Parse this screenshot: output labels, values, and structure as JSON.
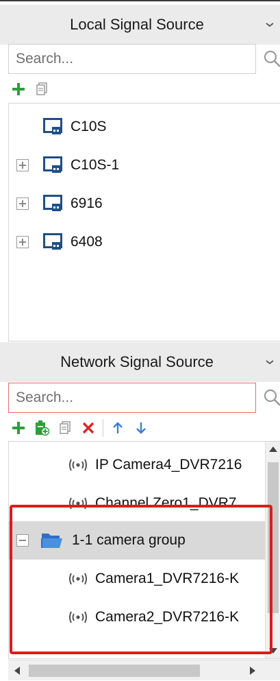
{
  "local": {
    "title": "Local Signal Source",
    "search_placeholder": "Search...",
    "items": [
      {
        "label": "C10S",
        "expandable": false
      },
      {
        "label": "C10S-1",
        "expandable": true
      },
      {
        "label": "6916",
        "expandable": true
      },
      {
        "label": "6408",
        "expandable": true
      }
    ]
  },
  "network": {
    "title": "Network Signal Source",
    "search_placeholder": "Search...",
    "items": [
      {
        "label": "IP Camera4_DVR7216",
        "type": "camera"
      },
      {
        "label": "Channel Zero1_DVR7",
        "type": "camera"
      },
      {
        "label": "1-1 camera group",
        "type": "group",
        "expanded": true,
        "selected": true
      },
      {
        "label": "Camera1_DVR7216-K",
        "type": "camera"
      },
      {
        "label": "Camera2_DVR7216-K",
        "type": "camera"
      }
    ]
  },
  "icons": {
    "add": "plus-icon",
    "add_group": "add-group-icon",
    "copy": "copy-icon",
    "delete": "delete-icon",
    "move_up": "arrow-up-icon",
    "move_down": "arrow-down-icon",
    "search": "search-icon",
    "collapse": "chevron-down-icon"
  },
  "colors": {
    "add": "#2e9e3a",
    "delete": "#e02424",
    "arrows": "#3a7fd6",
    "device_icon": "#1f4f86",
    "folder": "#2f6fc4",
    "highlight": "#e01a1a",
    "header_bg": "#ebebeb",
    "selected_row": "#d9d9d9"
  }
}
